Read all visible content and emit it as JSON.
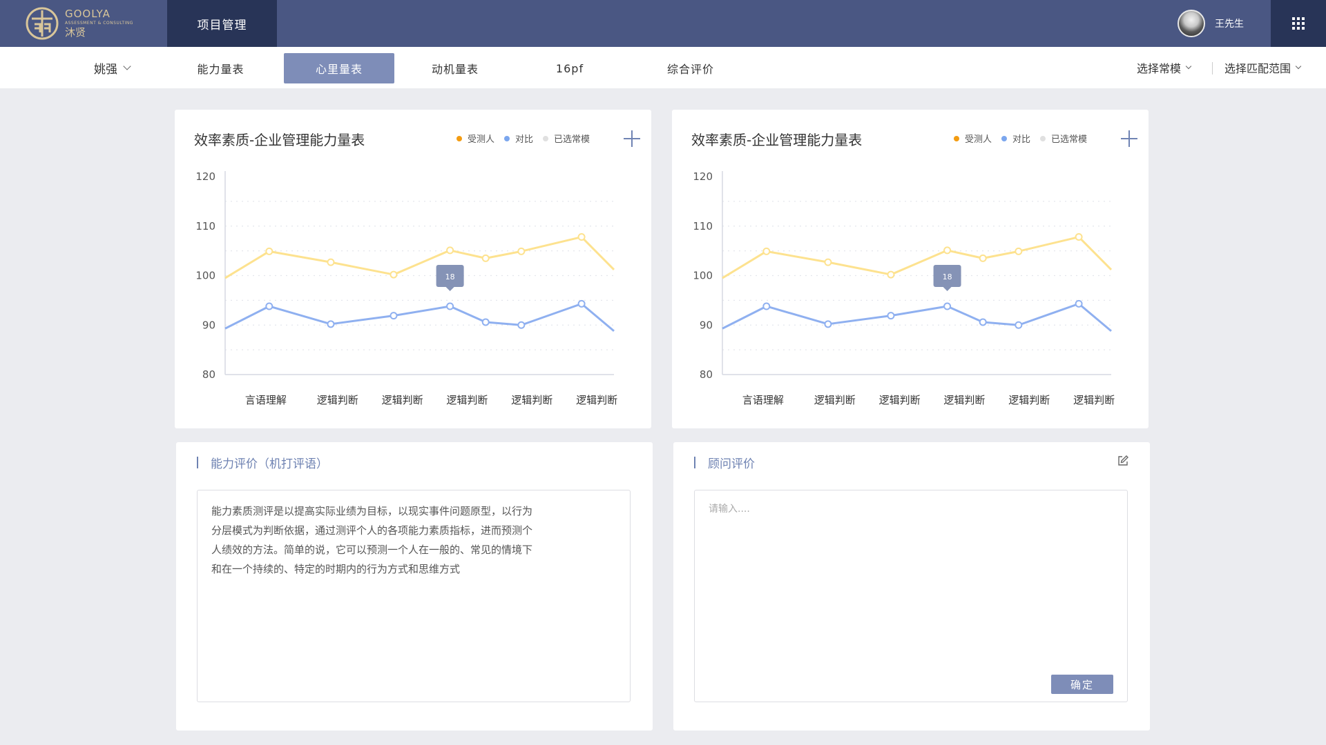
{
  "brand": {
    "name_en": "GOOLYA",
    "tagline": "ASSESSMENT & CONSULTING",
    "name_cn": "沐贤"
  },
  "header": {
    "active_nav": "项目管理",
    "username": "王先生"
  },
  "subnav": {
    "person": "姚强",
    "tabs": [
      "能力量表",
      "心里量表",
      "动机量表",
      "16pf",
      "综合评价"
    ],
    "active_tab_index": 1,
    "filter_norm": "选择常模",
    "filter_range": "选择匹配范围"
  },
  "colors": {
    "subject": "#f39c12",
    "compare": "#7ba6ee",
    "norm": "#e0e0e0",
    "yellow_line": "#fde28f",
    "blue_line": "#8fb0f0",
    "accent": "#7e8db8"
  },
  "chart_data": [
    {
      "type": "line",
      "title": "效率素质-企业管理能力量表",
      "legend": [
        "受测人",
        "对比",
        "已选常模"
      ],
      "categories": [
        "言语理解",
        "逻辑判断",
        "逻辑判断",
        "逻辑判断",
        "逻辑判断",
        "逻辑判断"
      ],
      "y_ticks": [
        "120",
        "110",
        "100",
        "90",
        "80"
      ],
      "ylim": [
        80,
        120
      ],
      "series": [
        {
          "name": "受测人",
          "x": [
            0,
            0.68,
            1.63,
            2.6,
            3.47,
            4.02,
            4.57,
            5.5,
            6.0
          ],
          "values": [
            99.5,
            104.9,
            102.7,
            100.2,
            105.1,
            103.5,
            104.9,
            107.8,
            101.2
          ]
        },
        {
          "name": "对比",
          "x": [
            0,
            0.68,
            1.63,
            2.6,
            3.47,
            4.02,
            4.57,
            5.5,
            6.0
          ],
          "values": [
            89.3,
            93.8,
            90.2,
            91.9,
            93.8,
            90.6,
            90.0,
            94.3,
            88.8
          ]
        }
      ],
      "tooltip": {
        "text": "18",
        "category_index": 3
      }
    },
    {
      "type": "line",
      "title": "效率素质-企业管理能力量表",
      "legend": [
        "受测人",
        "对比",
        "已选常模"
      ],
      "categories": [
        "言语理解",
        "逻辑判断",
        "逻辑判断",
        "逻辑判断",
        "逻辑判断",
        "逻辑判断"
      ],
      "y_ticks": [
        "120",
        "110",
        "100",
        "90",
        "80"
      ],
      "ylim": [
        80,
        120
      ],
      "series": [
        {
          "name": "受测人",
          "x": [
            0,
            0.68,
            1.63,
            2.6,
            3.47,
            4.02,
            4.57,
            5.5,
            6.0
          ],
          "values": [
            99.5,
            104.9,
            102.7,
            100.2,
            105.1,
            103.5,
            104.9,
            107.8,
            101.2
          ]
        },
        {
          "name": "对比",
          "x": [
            0,
            0.68,
            1.63,
            2.6,
            3.47,
            4.02,
            4.57,
            5.5,
            6.0
          ],
          "values": [
            89.3,
            93.8,
            90.2,
            91.9,
            93.8,
            90.6,
            90.0,
            94.3,
            88.8
          ]
        }
      ],
      "tooltip": {
        "text": "18",
        "category_index": 3
      }
    }
  ],
  "ability_eval": {
    "title": "能力评价（机打评语）",
    "lines": [
      "能力素质测评是以提高实际业绩为目标，以现实事件问题原型，以行为",
      "分层模式为判断依据，通过测评个人的各项能力素质指标，进而预测个",
      "人绩效的方法。简单的说，它可以预测一个人在一般的、常见的情境下",
      "和在一个持续的、特定的时期内的行为方式和思维方式"
    ]
  },
  "consultant_eval": {
    "title": "顾问评价",
    "placeholder": "请输入....",
    "confirm_label": "确定"
  }
}
